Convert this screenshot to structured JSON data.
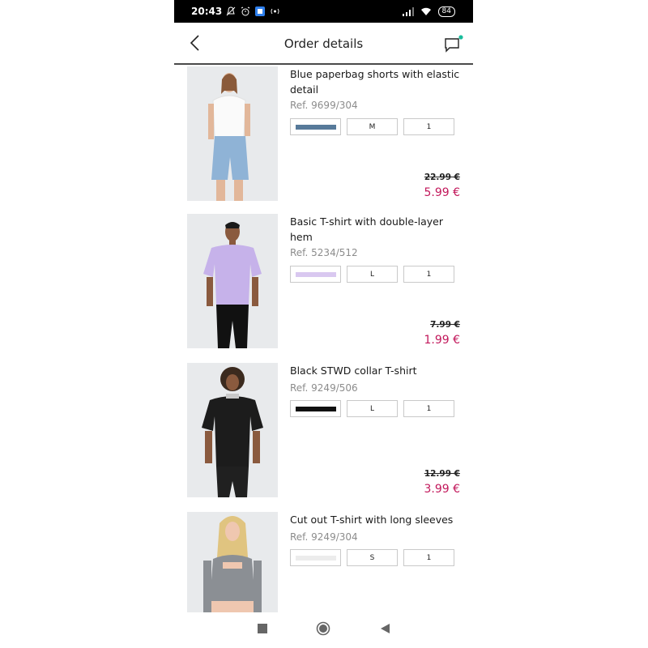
{
  "status_bar": {
    "time": "20:43",
    "battery": "84",
    "icons": [
      "mute-icon",
      "alarm-icon",
      "app-icon",
      "hotspot-icon",
      "signal-icon",
      "wifi-icon",
      "battery-icon"
    ]
  },
  "header": {
    "title": "Order details",
    "back_icon": "chevron-left-icon",
    "chat_icon": "chat-icon",
    "accent": "#1abc9c"
  },
  "items": [
    {
      "name": "Blue paperbag shorts with elastic detail",
      "ref": "Ref. 9699/304",
      "color": "#577a9a",
      "size": "M",
      "quantity": "1",
      "old_price": "22.99 €",
      "new_price": "5.99 €"
    },
    {
      "name": "Basic T-shirt with double-layer hem",
      "ref": "Ref. 5234/512",
      "color": "#d9c8f0",
      "size": "L",
      "quantity": "1",
      "old_price": "7.99 €",
      "new_price": "1.99 €"
    },
    {
      "name": "Black STWD collar T-shirt",
      "ref": "Ref. 9249/506",
      "color": "#111111",
      "size": "L",
      "quantity": "1",
      "old_price": "12.99 €",
      "new_price": "3.99 €"
    },
    {
      "name": "Cut out T-shirt with long sleeves",
      "ref": "Ref. 9249/304",
      "color": "#ececec",
      "size": "S",
      "quantity": "1"
    }
  ],
  "colors": {
    "sale_price": "#c2185b",
    "status_bar_bg": "#000000"
  },
  "nav_bar": {
    "icons": [
      "recents-square-icon",
      "home-circle-icon",
      "back-triangle-icon"
    ]
  }
}
